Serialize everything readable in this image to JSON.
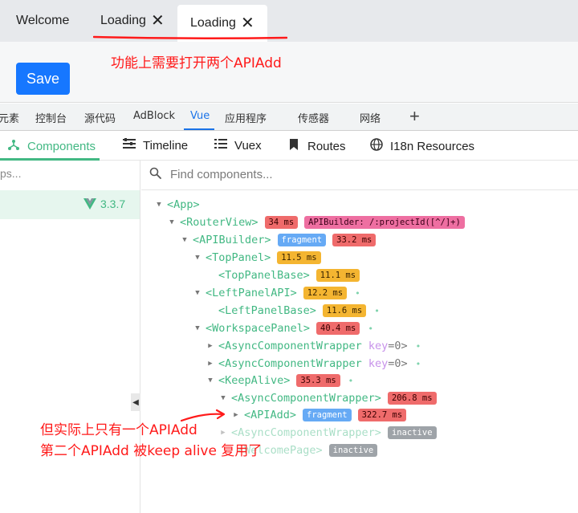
{
  "app_tabs": [
    {
      "label": "Welcome",
      "closable": false
    },
    {
      "label": "Loading",
      "closable": true,
      "close_icon": "✕"
    },
    {
      "label": "Loading",
      "closable": true,
      "close_icon": "✕",
      "active": true
    }
  ],
  "toolbar": {
    "save_label": "Save"
  },
  "annotations": {
    "top": "功能上需要打开两个APIAdd",
    "bottom_line1": "但实际上只有一个APIAdd",
    "bottom_line2": "第二个APIAdd 被keep alive 复用了",
    "color": "#ff1a1a"
  },
  "devtools_tabs": [
    "元素",
    "控制台",
    "源代码",
    "AdBlock",
    "Vue",
    "应用程序",
    "传感器",
    "网络"
  ],
  "devtools_active_tab": "Vue",
  "devtools_add": "+",
  "vue_nav": [
    {
      "label": "Components",
      "icon": "components-icon",
      "active": true
    },
    {
      "label": "Timeline",
      "icon": "timeline-icon"
    },
    {
      "label": "Vuex",
      "icon": "vuex-icon"
    },
    {
      "label": "Routes",
      "icon": "routes-icon"
    },
    {
      "label": "I18n Resources",
      "icon": "globe-icon"
    }
  ],
  "left_pane": {
    "search_text": "ps...",
    "app_version": "3.3.7"
  },
  "find": {
    "placeholder": "Find components..."
  },
  "tree": [
    {
      "name": "<App>"
    },
    {
      "name": "<RouterView>",
      "badges": [
        {
          "text": "34 ms",
          "color": "red"
        },
        {
          "text": "APIBuilder: /:projectId([^/]+)",
          "color": "pink"
        }
      ]
    },
    {
      "name": "<APIBuilder>",
      "badges": [
        {
          "text": "fragment",
          "color": "blue"
        },
        {
          "text": "33.2 ms",
          "color": "red"
        }
      ]
    },
    {
      "name": "<TopPanel>",
      "badges": [
        {
          "text": "11.5 ms",
          "color": "yellow"
        }
      ]
    },
    {
      "name": "<TopPanelBase>",
      "badges": [
        {
          "text": "11.1 ms",
          "color": "yellow"
        }
      ]
    },
    {
      "name": "<LeftPanelAPI>",
      "badges": [
        {
          "text": "12.2 ms",
          "color": "yellow"
        }
      ]
    },
    {
      "name": "<LeftPanelBase>",
      "badges": [
        {
          "text": "11.6 ms",
          "color": "yellow"
        }
      ]
    },
    {
      "name": "<WorkspacePanel>",
      "badges": [
        {
          "text": "40.4 ms",
          "color": "red"
        }
      ]
    },
    {
      "name": "<AsyncComponentWrapper",
      "attr_key": "key",
      "attr_val": "=0>"
    },
    {
      "name": "<AsyncComponentWrapper",
      "attr_key": "key",
      "attr_val": "=0>"
    },
    {
      "name": "<KeepAlive>",
      "badges": [
        {
          "text": "35.3 ms",
          "color": "red"
        }
      ]
    },
    {
      "name": "<AsyncComponentWrapper>",
      "badges": [
        {
          "text": "206.8 ms",
          "color": "red"
        }
      ]
    },
    {
      "name": "<APIAdd>",
      "badges": [
        {
          "text": "fragment",
          "color": "blue"
        },
        {
          "text": "322.7 ms",
          "color": "red"
        }
      ]
    },
    {
      "name": "<AsyncComponentWrapper>",
      "badges": [
        {
          "text": "inactive",
          "color": "gray"
        }
      ]
    },
    {
      "name": "<WelcomePage>",
      "badges": [
        {
          "text": "inactive",
          "color": "gray"
        }
      ]
    }
  ]
}
